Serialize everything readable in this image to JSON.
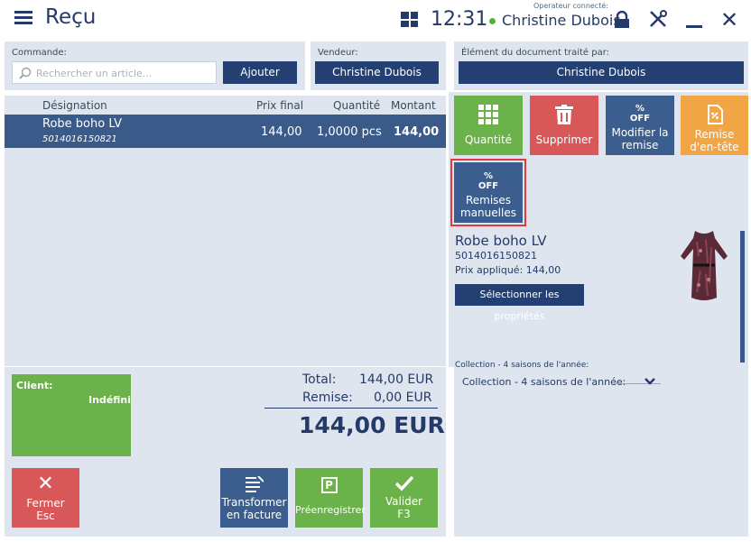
{
  "header": {
    "title": "Reçu",
    "time": "12:31",
    "operator_label": "Operateur connecté:",
    "operator_name": "Christine Dubois"
  },
  "order": {
    "commande_label": "Commande:",
    "search_placeholder": "Rechercher un article...",
    "add_label": "Ajouter",
    "vendeur_label": "Vendeur:",
    "vendeur_value": "Christine Dubois"
  },
  "document": {
    "processed_by_label": "Élément du document traité par:",
    "processed_by_value": "Christine Dubois"
  },
  "table": {
    "headers": [
      "Désignation",
      "Prix final",
      "Quantité",
      "Montant"
    ],
    "rows": [
      {
        "name": "Robe boho LV",
        "code": "5014016150821",
        "price": "144,00",
        "qty": "1,0000 pcs",
        "amount": "144,00"
      }
    ]
  },
  "actions": {
    "quantite": "Quantité",
    "supprimer": "Supprimer",
    "modifier_remise": "Modifier la remise",
    "remise_entete": "Remise d'en-tête",
    "remises_manuelles": "Remises manuelles",
    "off_badge": "% OFF"
  },
  "product": {
    "name": "Robe boho LV",
    "code": "5014016150821",
    "price_text": "Prix appliqué: 144,00",
    "select_props": "Sélectionner les propriétés",
    "collection_truncated": "Collection - 4 saisons de l'année:",
    "collection_label": "Collection - 4 saisons de l'année:"
  },
  "client": {
    "label": "Client:",
    "value": "Indéfini"
  },
  "totals": {
    "total_label": "Total:",
    "total_value": "144,00 EUR",
    "remise_label": "Remise:",
    "remise_value": "0,00 EUR",
    "grand_total": "144,00 EUR"
  },
  "footer": {
    "fermer": "Fermer",
    "fermer_key": "Esc",
    "transformer_1": "Transformer",
    "transformer_2": "en facture",
    "preenregistrer": "Préenregistrer",
    "valider": "Valider",
    "valider_key": "F3"
  },
  "colors": {
    "navy": "#243f72",
    "green": "#6ab249",
    "red": "#d8585a",
    "orange": "#f2a545",
    "panel": "#dee5ee",
    "highlight_border": "#e03a3a"
  }
}
